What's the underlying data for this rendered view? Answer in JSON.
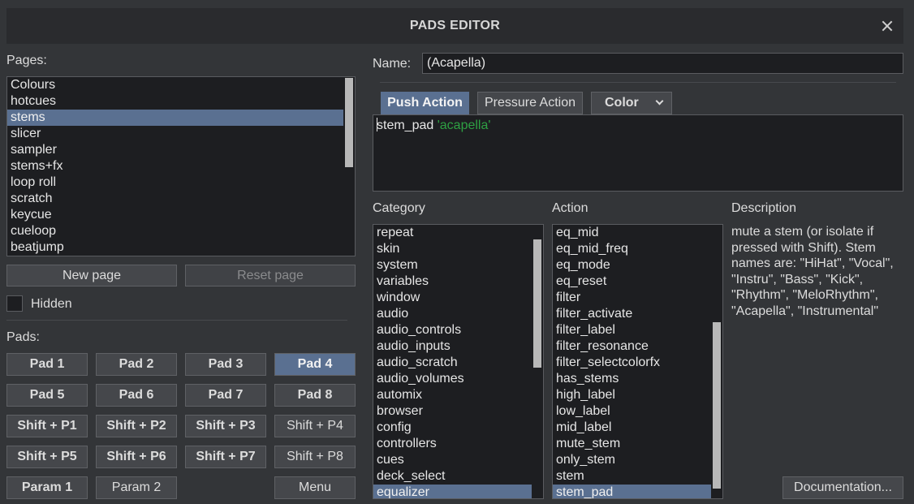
{
  "window": {
    "title": "PADS EDITOR"
  },
  "pages": {
    "label": "Pages:",
    "items": [
      "Colours",
      "hotcues",
      "stems",
      "slicer",
      "sampler",
      "stems+fx",
      "loop roll",
      "scratch",
      "keycue",
      "cueloop",
      "beatjump"
    ],
    "selected_index": 2,
    "new_page_label": "New page",
    "reset_page_label": "Reset page",
    "hidden_label": "Hidden"
  },
  "pads": {
    "label": "Pads:",
    "buttons": [
      [
        "Pad 1",
        "Pad 2",
        "Pad 3",
        "Pad 4"
      ],
      [
        "Pad 5",
        "Pad 6",
        "Pad 7",
        "Pad 8"
      ],
      [
        "Shift + P1",
        "Shift + P2",
        "Shift + P3",
        "Shift + P4"
      ],
      [
        "Shift + P5",
        "Shift + P6",
        "Shift + P7",
        "Shift + P8"
      ],
      [
        "Param 1",
        "Param 2",
        "",
        "Menu"
      ]
    ],
    "selected": "Pad 4"
  },
  "name": {
    "label": "Name:",
    "value": "(Acapella)"
  },
  "tabs": {
    "push": "Push Action",
    "pressure": "Pressure Action",
    "color": "Color"
  },
  "script": {
    "command": "stem_pad",
    "argument": "'acapella'"
  },
  "category": {
    "header": "Category",
    "items": [
      "repeat",
      "skin",
      "system",
      "variables",
      "window",
      "audio",
      "audio_controls",
      "audio_inputs",
      "audio_scratch",
      "audio_volumes",
      "automix",
      "browser",
      "config",
      "controllers",
      "cues",
      "deck_select",
      "equalizer"
    ],
    "selected": "equalizer"
  },
  "action": {
    "header": "Action",
    "items": [
      "eq_mid",
      "eq_mid_freq",
      "eq_mode",
      "eq_reset",
      "filter",
      "filter_activate",
      "filter_label",
      "filter_resonance",
      "filter_selectcolorfx",
      "has_stems",
      "high_label",
      "low_label",
      "mid_label",
      "mute_stem",
      "only_stem",
      "stem",
      "stem_pad"
    ],
    "selected": "stem_pad"
  },
  "description": {
    "header": "Description",
    "text": "mute a stem (or isolate if pressed with Shift). Stem names are: \"HiHat\", \"Vocal\", \"Instru\", \"Bass\", \"Kick\", \"Rhythm\", \"MeloRhythm\", \"Acapella\", \"Instrumental\""
  },
  "documentation_label": "Documentation..."
}
